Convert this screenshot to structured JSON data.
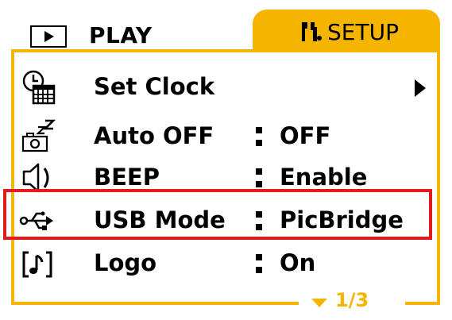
{
  "tabs": {
    "play": {
      "label": "PLAY"
    },
    "setup": {
      "label": "SETUP"
    }
  },
  "menu": {
    "items": [
      {
        "label": "Set Clock",
        "value": ""
      },
      {
        "label": "Auto OFF",
        "value": "OFF"
      },
      {
        "label": "BEEP",
        "value": "Enable"
      },
      {
        "label": "USB Mode",
        "value": "PicBridge"
      },
      {
        "label": "Logo",
        "value": "On"
      }
    ]
  },
  "pager": {
    "text": "1/3"
  },
  "colors": {
    "accent": "#f5b400",
    "highlight": "#e21b1b"
  },
  "icons": [
    "play-icon",
    "setup-tools-icon",
    "clock-calendar-icon",
    "camera-sleep-icon",
    "speaker-icon",
    "usb-icon",
    "logo-music-icon",
    "submenu-arrow-icon",
    "page-down-arrow-icon"
  ]
}
